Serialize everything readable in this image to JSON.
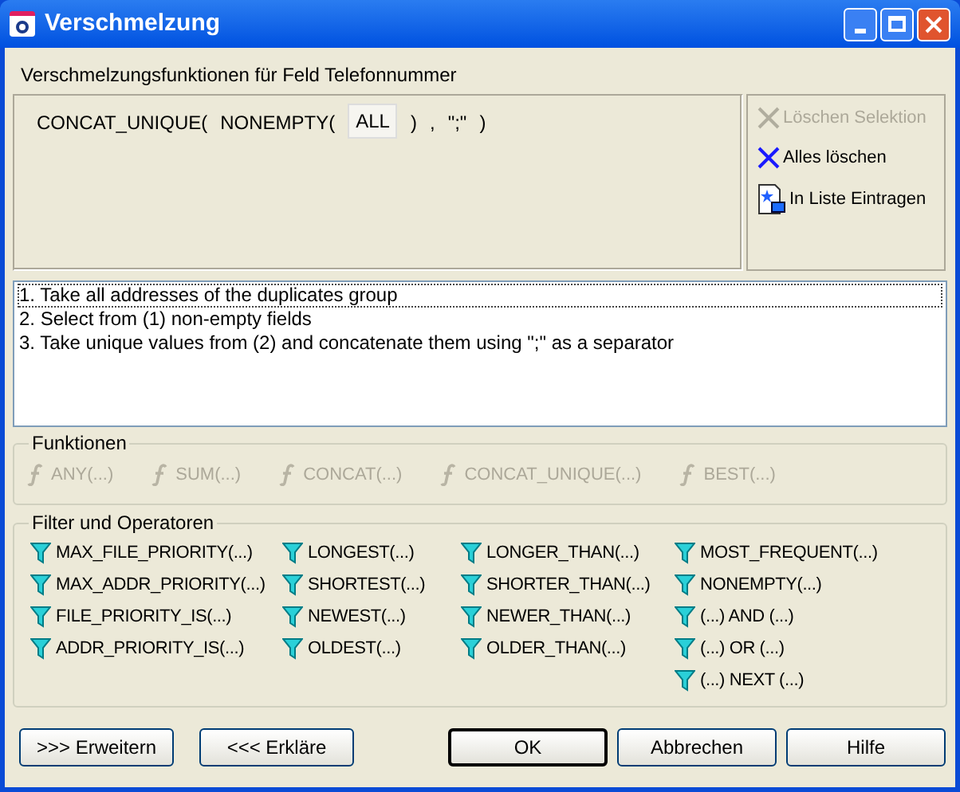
{
  "window": {
    "title": "Verschmelzung"
  },
  "heading": "Verschmelzungsfunktionen für Feld Telefonnummer",
  "expression": [
    {
      "text": "CONCAT_UNIQUE(",
      "selected": false
    },
    {
      "text": "NONEMPTY(",
      "selected": false
    },
    {
      "text": "ALL",
      "selected": true
    },
    {
      "text": ")",
      "selected": false
    },
    {
      "text": ",",
      "selected": false
    },
    {
      "text": "\";\"",
      "selected": false
    },
    {
      "text": ")",
      "selected": false
    }
  ],
  "actions": [
    {
      "kind": "delete",
      "label": "Löschen Selektion",
      "disabled": true
    },
    {
      "kind": "delete",
      "label": "Alles löschen",
      "disabled": false
    },
    {
      "kind": "insert",
      "label": "In Liste Eintragen",
      "disabled": false
    }
  ],
  "explanation": [
    {
      "text": "1. Take all addresses of the duplicates group",
      "selected": true
    },
    {
      "text": "2. Select from (1) non-empty fields",
      "selected": false
    },
    {
      "text": "3. Take unique values from (2) and concatenate them using \";\" as a separator",
      "selected": false
    }
  ],
  "functions": {
    "title": "Funktionen",
    "items": [
      {
        "label": "ANY(...)",
        "disabled": true
      },
      {
        "label": "SUM(...)",
        "disabled": true
      },
      {
        "label": "CONCAT(...)",
        "disabled": true
      },
      {
        "label": "CONCAT_UNIQUE(...)",
        "disabled": true
      },
      {
        "label": "BEST(...)",
        "disabled": true
      }
    ]
  },
  "filters": {
    "title": "Filter und Operatoren",
    "columns": [
      [
        "MAX_FILE_PRIORITY(...)",
        "MAX_ADDR_PRIORITY(...)",
        "FILE_PRIORITY_IS(...)",
        "ADDR_PRIORITY_IS(...)"
      ],
      [
        "LONGEST(...)",
        "SHORTEST(...)",
        "NEWEST(...)",
        "OLDEST(...)"
      ],
      [
        "LONGER_THAN(...)",
        "SHORTER_THAN(...)",
        "NEWER_THAN(...)",
        "OLDER_THAN(...)"
      ],
      [
        "MOST_FREQUENT(...)",
        "NONEMPTY(...)",
        "(...) AND (...)",
        "(...) OR (...)",
        "(...) NEXT (...)"
      ]
    ]
  },
  "buttons_left": [
    ">>> Erweitern",
    "<<< Erkläre"
  ],
  "buttons_right": [
    {
      "label": "OK",
      "default": true
    },
    {
      "label": "Abbrechen",
      "default": false
    },
    {
      "label": "Hilfe",
      "default": false
    }
  ]
}
